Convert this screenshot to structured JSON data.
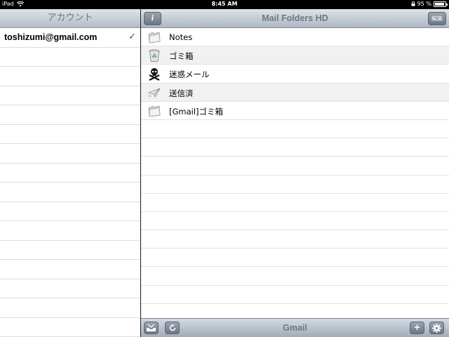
{
  "status_bar": {
    "device": "iPad",
    "time": "8:45 AM",
    "battery": "95 %",
    "battery_level": 0.95
  },
  "accounts_pane": {
    "title": "アカウント",
    "accounts": [
      {
        "name": "toshizumi@gmail.com",
        "selected": true,
        "check": "✓"
      }
    ]
  },
  "folders_pane": {
    "title": "Mail Folders HD",
    "info_button": "i",
    "edit_button": "編集",
    "folders": [
      {
        "label": "Notes",
        "icon": "folder-icon"
      },
      {
        "label": "ゴミ箱",
        "icon": "trash-icon"
      },
      {
        "label": "迷惑メール",
        "icon": "skull-crossbones-icon"
      },
      {
        "label": "送信済",
        "icon": "paper-plane-icon"
      },
      {
        "label": "[Gmail]ゴミ箱",
        "icon": "folder-icon"
      }
    ]
  },
  "toolbar": {
    "title": "Gmail",
    "inbox_icon": "inbox-tray-icon",
    "refresh_icon": "refresh-icon",
    "add_label": "+",
    "settings_icon": "gear-icon"
  },
  "colors": {
    "checkmark": "#385487",
    "nav_title": "#6f7780",
    "alt_row": "#f1f1f1"
  }
}
